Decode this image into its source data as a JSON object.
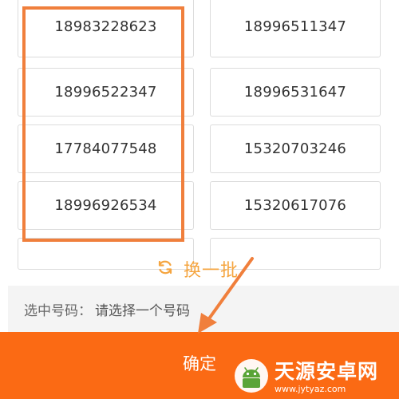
{
  "numbers": {
    "left": [
      "18983228623",
      "18996522347",
      "17784077548",
      "18996926534"
    ],
    "right": [
      "18996511347",
      "18996531647",
      "15320703246",
      "15320617076"
    ]
  },
  "refresh": {
    "label": "换一批",
    "icon": "refresh-icon"
  },
  "selected": {
    "label": "选中号码：",
    "value": "请选择一个号码"
  },
  "confirm_label": "确定",
  "watermark": {
    "title": "天源安卓网",
    "url": "www.jytyaz.com"
  },
  "colors": {
    "accent_orange": "#fb6a14",
    "highlight_box": "#f07f3c",
    "refresh_text": "#f5a540",
    "annotation_arrow": "#f07f3c"
  }
}
